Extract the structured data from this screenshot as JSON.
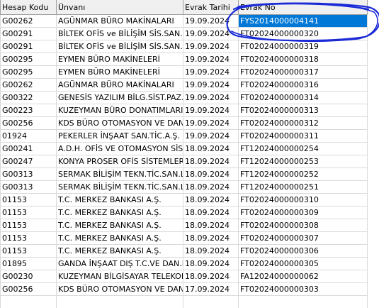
{
  "columns": [
    "Hesap Kodu",
    "Ünvanı",
    "Evrak Tarihi",
    "Evrak No"
  ],
  "rows": [
    [
      "G00262",
      "AGÜNMAR BÜRO MAKİNALARI",
      "19.09.2024",
      "FYS2014000004141"
    ],
    [
      "G00291",
      "BİLTEK OFİS ve BİLİŞİM SİS.SAN.ve",
      "19.09.2024",
      "FT02024000000320"
    ],
    [
      "G00291",
      "BİLTEK OFİS ve BİLİŞİM SİS.SAN.ve",
      "19.09.2024",
      "FT02024000000319"
    ],
    [
      "G00295",
      "EYMEN BÜRO MAKİNELERİ",
      "19.09.2024",
      "FT02024000000318"
    ],
    [
      "G00295",
      "EYMEN BÜRO MAKİNELERİ",
      "19.09.2024",
      "FT02024000000317"
    ],
    [
      "G00262",
      "AGÜNMAR BÜRO MAKİNALARI",
      "19.09.2024",
      "FT02024000000316"
    ],
    [
      "G00322",
      "GENESİS YAZILIM BİLG.SİST.PAZ.Tİ",
      "19.09.2024",
      "FT02024000000314"
    ],
    [
      "G00223",
      "KUZEYMAN BÜRO DONATIMLARI",
      "19.09.2024",
      "FT02024000000313"
    ],
    [
      "G00256",
      "KDS BÜRO OTOMASYON VE DANIŞM",
      "19.09.2024",
      "FT02024000000312"
    ],
    [
      "01924",
      "PEKERLER İNŞAAT SAN.TİC.A.Ş.",
      "19.09.2024",
      "FT02024000000311"
    ],
    [
      "G00241",
      "A.D.H. OFİS VE OTOMASYON SİST",
      "18.09.2024",
      "FT12024000000254"
    ],
    [
      "G00247",
      "KONYA PROSER OFİS SİSTEMLERİ T",
      "18.09.2024",
      "FT12024000000253"
    ],
    [
      "G00313",
      "SERMAK BİLİŞİM TEKN.TİC.SAN.LİM",
      "18.09.2024",
      "FT12024000000252"
    ],
    [
      "G00313",
      "SERMAK BİLİŞİM TEKN.TİC.SAN.LİM",
      "18.09.2024",
      "FT12024000000251"
    ],
    [
      "01153",
      "T.C. MERKEZ BANKASI A.Ş.",
      "18.09.2024",
      "FT02024000000310"
    ],
    [
      "01153",
      "T.C. MERKEZ BANKASI A.Ş.",
      "18.09.2024",
      "FT02024000000309"
    ],
    [
      "01153",
      "T.C. MERKEZ BANKASI A.Ş.",
      "18.09.2024",
      "FT02024000000308"
    ],
    [
      "01153",
      "T.C. MERKEZ BANKASI A.Ş.",
      "18.09.2024",
      "FT02024000000307"
    ],
    [
      "01153",
      "T.C. MERKEZ BANKASI A.Ş.",
      "18.09.2024",
      "FT02024000000306"
    ],
    [
      "01895",
      "GANDA İNŞAAT DIŞ T.C.VE DAN.LTD",
      "18.09.2024",
      "FT02024000000305"
    ],
    [
      "G00230",
      "KUZEYMAN BİLGİSAYAR TELEKOMÜN",
      "18.09.2024",
      "FA12024000000062"
    ],
    [
      "G00256",
      "KDS BÜRO OTOMASYON VE DANIŞM",
      "17.09.2024",
      "FT02024000000303"
    ],
    [
      "",
      "",
      "",
      ""
    ]
  ],
  "selected_row": 0,
  "selected_column": 3,
  "colors": {
    "selection": "#0078d7",
    "annotation": "#1a2bd6",
    "header_bg": "#f0f0f0"
  }
}
